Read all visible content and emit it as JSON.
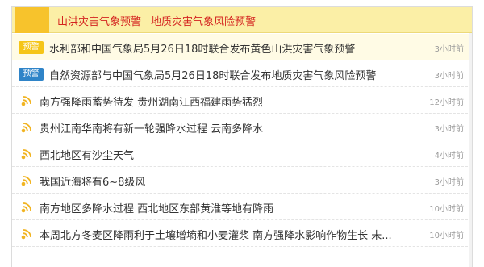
{
  "header": {
    "links": [
      "山洪灾害气象预警",
      "地质灾害气象风险预警"
    ]
  },
  "items": [
    {
      "type": "badge",
      "badge": "预警",
      "badge_color": "#f5c518",
      "title": "水利部和中国气象局5月26日18时联合发布黄色山洪灾害气象预警",
      "time": "3小时前",
      "highlight": true
    },
    {
      "type": "badge",
      "badge": "预警",
      "badge_color": "#2f84c8",
      "title": "自然资源部与中国气象局5月26日18时联合发布地质灾害气象风险预警",
      "time": "3小时前"
    },
    {
      "type": "broadcast",
      "icon": "broadcast-icon",
      "title": "南方强降雨蓄势待发 贵州湖南江西福建雨势猛烈",
      "time": "12小时前"
    },
    {
      "type": "broadcast",
      "icon": "broadcast-icon",
      "title": "贵州江南华南将有新一轮强降水过程 云南多降水",
      "time": "3小时前"
    },
    {
      "type": "broadcast",
      "icon": "broadcast-icon",
      "title": "西北地区有沙尘天气",
      "time": "4小时前"
    },
    {
      "type": "broadcast",
      "icon": "broadcast-icon",
      "title": "我国近海将有6~8级风",
      "time": "3小时前"
    },
    {
      "type": "broadcast",
      "icon": "broadcast-icon",
      "title": "南方地区多降水过程 西北地区东部黄淮等地有降雨",
      "time": "10小时前"
    },
    {
      "type": "broadcast",
      "icon": "broadcast-icon",
      "title": "本周北方冬麦区降雨利于土壤增墒和小麦灌浆 南方强降水影响作物生长 未...",
      "time": "10小时前"
    }
  ]
}
